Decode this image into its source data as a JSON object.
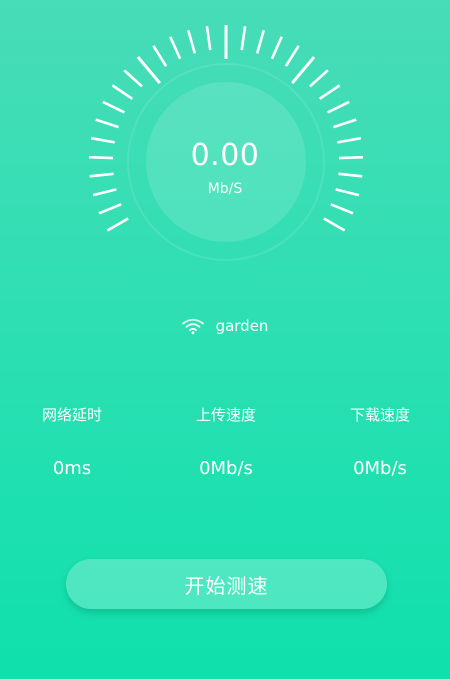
{
  "gauge": {
    "speed_value": "0.00",
    "speed_unit": "Mb/S",
    "level": 0
  },
  "network": {
    "icon": "wifi-icon",
    "ssid": "garden"
  },
  "stats": {
    "latency": {
      "label": "网络延时",
      "value": "0ms"
    },
    "upload": {
      "label": "上传速度",
      "value": "0Mb/s"
    },
    "download": {
      "label": "下载速度",
      "value": "0Mb/s"
    }
  },
  "start_button": {
    "label": "开始测速"
  }
}
